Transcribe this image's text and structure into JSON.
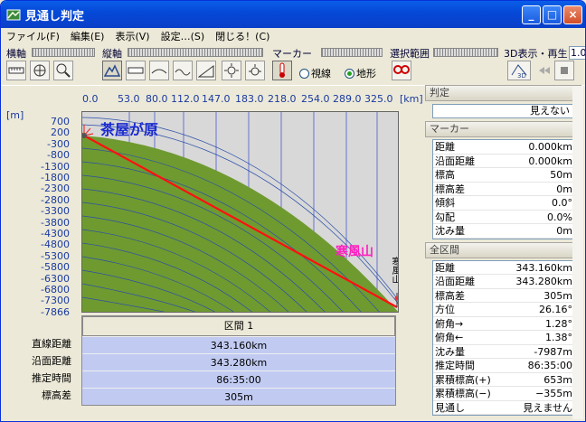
{
  "window": {
    "title": "見通し判定",
    "min": "_",
    "max": "□",
    "close": "×"
  },
  "menu": [
    "ファイル(F)",
    "編集(E)",
    "表示(V)",
    "設定…(S)",
    "閉じる！(C)"
  ],
  "toolbar": {
    "horiz_label": "横軸",
    "vert_label": "縦軸",
    "marker_label": "マーカー",
    "range_label": "選択範囲",
    "view3d_label": "3D表示・再生",
    "view3d_value": "1.0",
    "radio_sight": "視線",
    "radio_terrain": "地形",
    "btn_3d": "3D"
  },
  "x_axis": {
    "unit": "[km]",
    "ticks": [
      "0.0",
      "53.0",
      "80.0",
      "112.0",
      "147.0",
      "183.0",
      "218.0",
      "254.0",
      "289.0",
      "325.0"
    ]
  },
  "y_axis": {
    "unit": "[m]",
    "ticks": [
      "700",
      "200",
      "-300",
      "-800",
      "-1300",
      "-1800",
      "-2300",
      "-2800",
      "-3300",
      "-3800",
      "-4300",
      "-4800",
      "-5300",
      "-5800",
      "-6300",
      "-6800",
      "-7300",
      "-7866"
    ]
  },
  "plot": {
    "start_label": "茶屋が原",
    "end_label": "寒風山",
    "end_label_vertical": "寒風山",
    "line_color": "#ff0000",
    "terrain_color": "#6a9a2a"
  },
  "section": {
    "header": "区間 1",
    "labels": [
      "直線距離",
      "沿面距離",
      "推定時間",
      "標高差"
    ],
    "values": [
      "343.160km",
      "343.280km",
      "86:35:00",
      "305m"
    ]
  },
  "panel": {
    "judge_title": "判定",
    "judge_value": "見えない",
    "marker_title": "マーカー",
    "marker_rows": [
      {
        "k": "距離",
        "v": "0.000km"
      },
      {
        "k": "沿面距離",
        "v": "0.000km"
      },
      {
        "k": "標高",
        "v": "50m"
      },
      {
        "k": "標高差",
        "v": "0m"
      },
      {
        "k": "傾斜",
        "v": "0.0°"
      },
      {
        "k": "勾配",
        "v": "0.0%"
      },
      {
        "k": "沈み量",
        "v": "0m"
      }
    ],
    "all_title": "全区間",
    "all_rows": [
      {
        "k": "距離",
        "v": "343.160km"
      },
      {
        "k": "沿面距離",
        "v": "343.280km"
      },
      {
        "k": "標高差",
        "v": "305m"
      },
      {
        "k": "方位",
        "v": "26.16°"
      },
      {
        "k": "俯角→",
        "v": "1.28°"
      },
      {
        "k": "俯角←",
        "v": "1.38°"
      },
      {
        "k": "沈み量",
        "v": "-7987m"
      },
      {
        "k": "推定時間",
        "v": "86:35:00"
      },
      {
        "k": "累積標高(+)",
        "v": "653m"
      },
      {
        "k": "累積標高(−)",
        "v": "−355m"
      },
      {
        "k": "見通し",
        "v": "見えません"
      }
    ]
  }
}
